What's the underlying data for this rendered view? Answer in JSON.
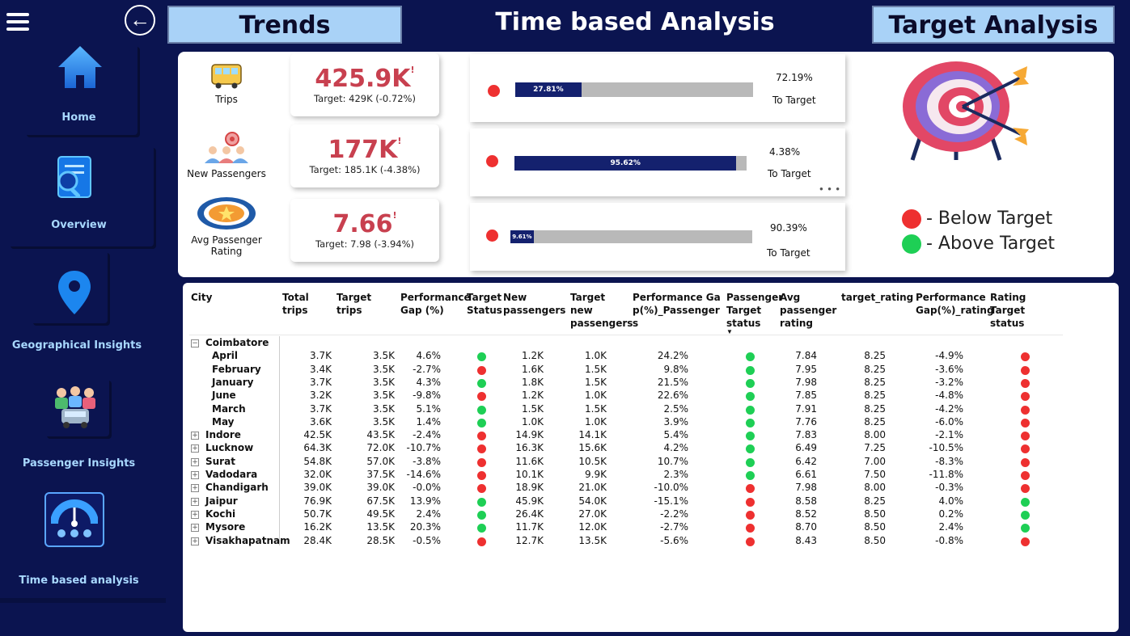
{
  "header": {
    "trends_label": "Trends",
    "title": "Time based Analysis",
    "target_label": "Target Analysis"
  },
  "nav": {
    "back_glyph": "←",
    "items": [
      {
        "label": "Home",
        "icon": "home-icon"
      },
      {
        "label": "Overview",
        "icon": "document-search-icon"
      },
      {
        "label": "Geographical Insights",
        "icon": "map-pin-icon"
      },
      {
        "label": "Passenger Insights",
        "icon": "passengers-icon"
      },
      {
        "label": "Time based  analysis",
        "icon": "gauge-icon"
      }
    ]
  },
  "kpis": [
    {
      "label": "Trips",
      "value": "425.9K",
      "target": "Target: 429K (-0.72%)",
      "icon": "bus-icon"
    },
    {
      "label": "New Passengers",
      "value": "177K",
      "target": "Target: 185.1K (-4.38%)",
      "icon": "people-target-icon"
    },
    {
      "label_line1": "Avg Passenger",
      "label_line2": "Rating",
      "value": "7.66",
      "target": "Target: 7.98 (-3.94%)",
      "icon": "rating-icon"
    }
  ],
  "bars": [
    {
      "fill_label": "27.81%",
      "fill": 0.2781,
      "remaining": "72.19%",
      "to_target": "To Target",
      "status": "red"
    },
    {
      "fill_label": "95.62%",
      "fill": 0.9562,
      "remaining": "4.38%",
      "to_target": "To Target",
      "status": "red"
    },
    {
      "fill_label": "9.61%",
      "fill": 0.0961,
      "remaining": "90.39%",
      "to_target": "To Target",
      "status": "red"
    }
  ],
  "legend": {
    "below": "- Below Target",
    "above": "- Above Target"
  },
  "colors": {
    "navy": "#0b1450",
    "red": "#ee3030",
    "green": "#1ecf55",
    "kpi_red": "#c8404f"
  },
  "table": {
    "headers": {
      "city": "City",
      "total_trips": "Total trips",
      "target_trips": "Target trips",
      "perf_gap": "Performance Gap (%)",
      "target_status": "Target Status",
      "new_passengers": "New passengers",
      "target_new_passengers": "Target new passengers",
      "perf_gap_passengers": "Performance Gap(%)_Passengers",
      "passenger_target_status": "Passenger Target status",
      "avg_rating": "Avg passenger rating",
      "target_rating": "target_rating",
      "perf_gap_rating": "Performance Gap(%)_rating",
      "rating_target_status": "Rating Target status"
    },
    "rows": [
      {
        "name": "Coimbatore",
        "level": 0,
        "expand": "−",
        "total": "",
        "target": "",
        "gap": "",
        "ts": "",
        "newp": "",
        "tnewp": "",
        "gapp": "",
        "pts": "",
        "avg": "",
        "trat": "",
        "gapr": "",
        "rts": ""
      },
      {
        "name": "April",
        "level": 1,
        "expand": "",
        "total": "3.7K",
        "target": "3.5K",
        "gap": "4.6%",
        "ts": "green",
        "newp": "1.2K",
        "tnewp": "1.0K",
        "gapp": "24.2%",
        "pts": "green",
        "avg": "7.84",
        "trat": "8.25",
        "gapr": "-4.9%",
        "rts": "red"
      },
      {
        "name": "February",
        "level": 1,
        "expand": "",
        "total": "3.4K",
        "target": "3.5K",
        "gap": "-2.7%",
        "ts": "red",
        "newp": "1.6K",
        "tnewp": "1.5K",
        "gapp": "9.8%",
        "pts": "green",
        "avg": "7.95",
        "trat": "8.25",
        "gapr": "-3.6%",
        "rts": "red"
      },
      {
        "name": "January",
        "level": 1,
        "expand": "",
        "total": "3.7K",
        "target": "3.5K",
        "gap": "4.3%",
        "ts": "green",
        "newp": "1.8K",
        "tnewp": "1.5K",
        "gapp": "21.5%",
        "pts": "green",
        "avg": "7.98",
        "trat": "8.25",
        "gapr": "-3.2%",
        "rts": "red"
      },
      {
        "name": "June",
        "level": 1,
        "expand": "",
        "total": "3.2K",
        "target": "3.5K",
        "gap": "-9.8%",
        "ts": "red",
        "newp": "1.2K",
        "tnewp": "1.0K",
        "gapp": "22.6%",
        "pts": "green",
        "avg": "7.85",
        "trat": "8.25",
        "gapr": "-4.8%",
        "rts": "red"
      },
      {
        "name": "March",
        "level": 1,
        "expand": "",
        "total": "3.7K",
        "target": "3.5K",
        "gap": "5.1%",
        "ts": "green",
        "newp": "1.5K",
        "tnewp": "1.5K",
        "gapp": "2.5%",
        "pts": "green",
        "avg": "7.91",
        "trat": "8.25",
        "gapr": "-4.2%",
        "rts": "red"
      },
      {
        "name": "May",
        "level": 1,
        "expand": "",
        "total": "3.6K",
        "target": "3.5K",
        "gap": "1.4%",
        "ts": "green",
        "newp": "1.0K",
        "tnewp": "1.0K",
        "gapp": "3.9%",
        "pts": "green",
        "avg": "7.76",
        "trat": "8.25",
        "gapr": "-6.0%",
        "rts": "red"
      },
      {
        "name": "Indore",
        "level": 0,
        "expand": "+",
        "total": "42.5K",
        "target": "43.5K",
        "gap": "-2.4%",
        "ts": "red",
        "newp": "14.9K",
        "tnewp": "14.1K",
        "gapp": "5.4%",
        "pts": "green",
        "avg": "7.83",
        "trat": "8.00",
        "gapr": "-2.1%",
        "rts": "red"
      },
      {
        "name": "Lucknow",
        "level": 0,
        "expand": "+",
        "total": "64.3K",
        "target": "72.0K",
        "gap": "-10.7%",
        "ts": "red",
        "newp": "16.3K",
        "tnewp": "15.6K",
        "gapp": "4.2%",
        "pts": "green",
        "avg": "6.49",
        "trat": "7.25",
        "gapr": "-10.5%",
        "rts": "red"
      },
      {
        "name": "Surat",
        "level": 0,
        "expand": "+",
        "total": "54.8K",
        "target": "57.0K",
        "gap": "-3.8%",
        "ts": "red",
        "newp": "11.6K",
        "tnewp": "10.5K",
        "gapp": "10.7%",
        "pts": "green",
        "avg": "6.42",
        "trat": "7.00",
        "gapr": "-8.3%",
        "rts": "red"
      },
      {
        "name": "Vadodara",
        "level": 0,
        "expand": "+",
        "total": "32.0K",
        "target": "37.5K",
        "gap": "-14.6%",
        "ts": "red",
        "newp": "10.1K",
        "tnewp": "9.9K",
        "gapp": "2.3%",
        "pts": "green",
        "avg": "6.61",
        "trat": "7.50",
        "gapr": "-11.8%",
        "rts": "red"
      },
      {
        "name": "Chandigarh",
        "level": 0,
        "expand": "+",
        "total": "39.0K",
        "target": "39.0K",
        "gap": "-0.0%",
        "ts": "red",
        "newp": "18.9K",
        "tnewp": "21.0K",
        "gapp": "-10.0%",
        "pts": "red",
        "avg": "7.98",
        "trat": "8.00",
        "gapr": "-0.3%",
        "rts": "red"
      },
      {
        "name": "Jaipur",
        "level": 0,
        "expand": "+",
        "total": "76.9K",
        "target": "67.5K",
        "gap": "13.9%",
        "ts": "green",
        "newp": "45.9K",
        "tnewp": "54.0K",
        "gapp": "-15.1%",
        "pts": "red",
        "avg": "8.58",
        "trat": "8.25",
        "gapr": "4.0%",
        "rts": "green"
      },
      {
        "name": "Kochi",
        "level": 0,
        "expand": "+",
        "total": "50.7K",
        "target": "49.5K",
        "gap": "2.4%",
        "ts": "green",
        "newp": "26.4K",
        "tnewp": "27.0K",
        "gapp": "-2.2%",
        "pts": "red",
        "avg": "8.52",
        "trat": "8.50",
        "gapr": "0.2%",
        "rts": "green"
      },
      {
        "name": "Mysore",
        "level": 0,
        "expand": "+",
        "total": "16.2K",
        "target": "13.5K",
        "gap": "20.3%",
        "ts": "green",
        "newp": "11.7K",
        "tnewp": "12.0K",
        "gapp": "-2.7%",
        "pts": "red",
        "avg": "8.70",
        "trat": "8.50",
        "gapr": "2.4%",
        "rts": "green"
      },
      {
        "name": "Visakhapatnam",
        "level": 0,
        "expand": "+",
        "total": "28.4K",
        "target": "28.5K",
        "gap": "-0.5%",
        "ts": "red",
        "newp": "12.7K",
        "tnewp": "13.5K",
        "gapp": "-5.6%",
        "pts": "red",
        "avg": "8.43",
        "trat": "8.50",
        "gapr": "-0.8%",
        "rts": "red"
      }
    ]
  }
}
